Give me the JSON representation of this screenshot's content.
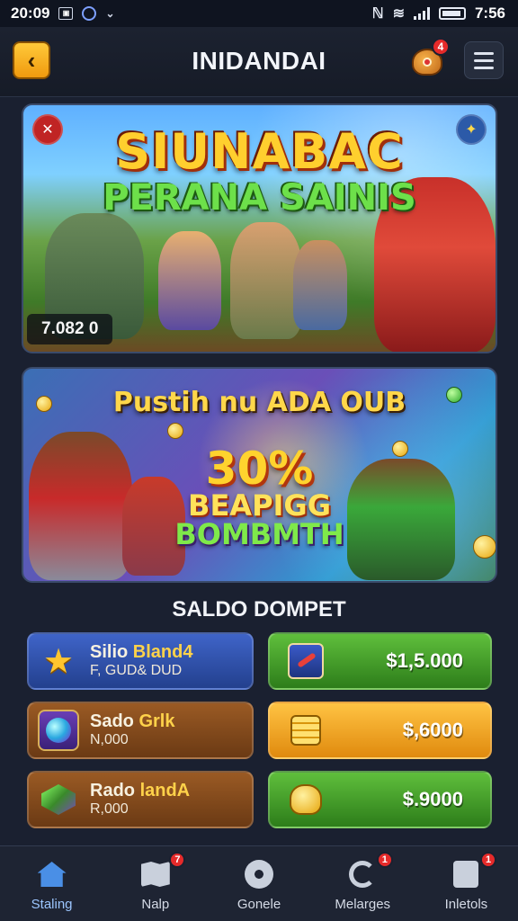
{
  "status_bar": {
    "time_left": "20:09",
    "time_right": "7:56"
  },
  "header": {
    "title": "INIDANDAI",
    "bag_badge": "4"
  },
  "banner1": {
    "title": "SIUNABAC",
    "subtitle": "PERANA SAINIS",
    "counter": "7.082 0"
  },
  "banner2": {
    "title": "Pustih nu ADA OUB",
    "promo_line1": "30%",
    "promo_line2": "BEAPIGG",
    "promo_line3": "BOMBMTH"
  },
  "wallet": {
    "section_title": "SALDO DOMPET",
    "cards": [
      {
        "name": "Silio",
        "name_accent": "Bland4",
        "sub": "F, GUD& DUD",
        "icon": "star-icon"
      },
      {
        "name": "Sado",
        "name_accent": "Grlk",
        "sub": "N,000",
        "icon": "orb-icon"
      },
      {
        "name": "Rado",
        "name_accent": "landA",
        "sub": "R,000",
        "icon": "gem-icon"
      }
    ],
    "amounts": [
      {
        "value": "$1,5.000",
        "icon": "scroll-icon"
      },
      {
        "value": "$,6000",
        "icon": "coins-icon"
      },
      {
        "value": "$.9000",
        "icon": "money-bag-icon"
      }
    ]
  },
  "bottom_nav": [
    {
      "label": "Staling",
      "icon": "home-icon",
      "badge": ""
    },
    {
      "label": "Nalp",
      "icon": "map-icon",
      "badge": "7"
    },
    {
      "label": "Gonele",
      "icon": "gear-icon",
      "badge": ""
    },
    {
      "label": "Melarges",
      "icon": "ring-icon",
      "badge": "1"
    },
    {
      "label": "Inletols",
      "icon": "box-icon",
      "badge": "1"
    }
  ]
}
